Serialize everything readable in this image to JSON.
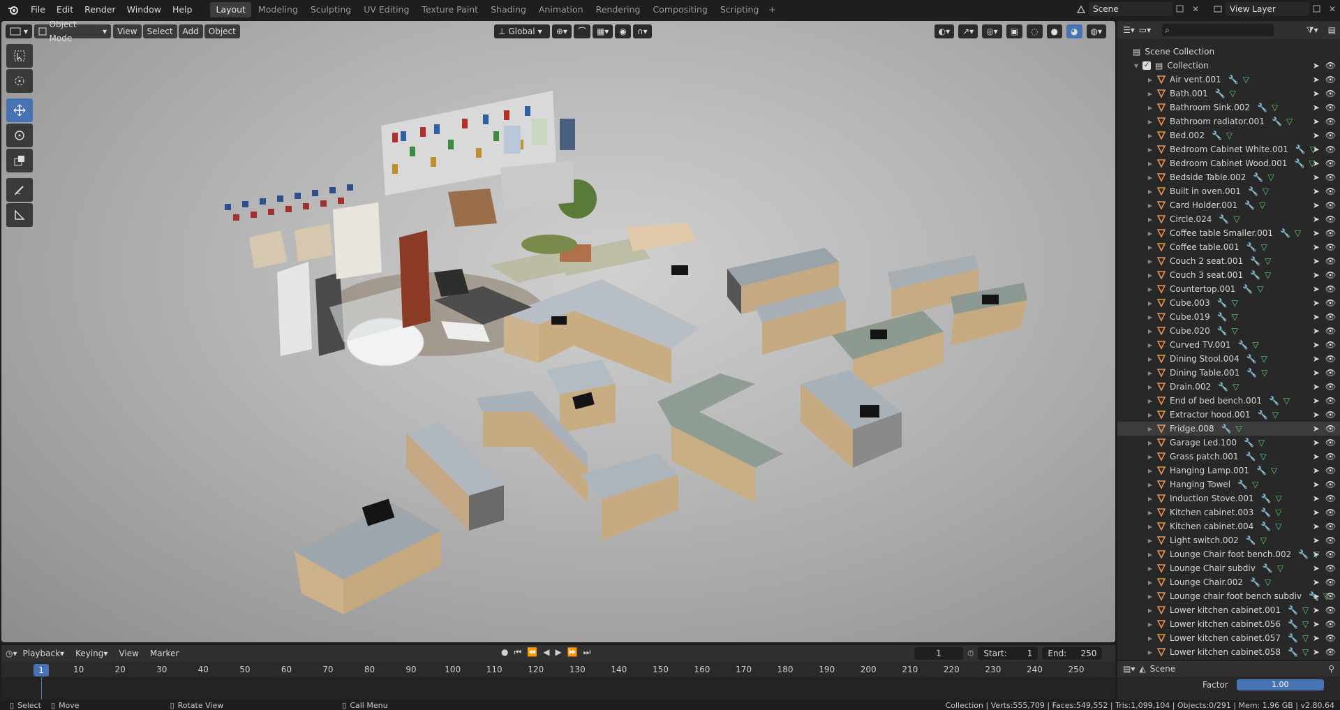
{
  "topbar": {
    "menus": [
      "File",
      "Edit",
      "Render",
      "Window",
      "Help"
    ],
    "workspaces": [
      "Layout",
      "Modeling",
      "Sculpting",
      "UV Editing",
      "Texture Paint",
      "Shading",
      "Animation",
      "Rendering",
      "Compositing",
      "Scripting"
    ],
    "active_workspace": "Layout",
    "scene_name": "Scene",
    "view_layer": "View Layer"
  },
  "viewport": {
    "mode": "Object Mode",
    "menus": [
      "View",
      "Select",
      "Add",
      "Object"
    ],
    "transform_orientation": "Global"
  },
  "outliner": {
    "root": "Scene Collection",
    "collection": "Collection",
    "items": [
      "Air vent.001",
      "Bath.001",
      "Bathroom Sink.002",
      "Bathroom radiator.001",
      "Bed.002",
      "Bedroom Cabinet White.001",
      "Bedroom Cabinet Wood.001",
      "Bedside Table.002",
      "Built in oven.001",
      "Card Holder.001",
      "Circle.024",
      "Coffee table Smaller.001",
      "Coffee table.001",
      "Couch 2 seat.001",
      "Couch 3 seat.001",
      "Countertop.001",
      "Cube.003",
      "Cube.019",
      "Cube.020",
      "Curved TV.001",
      "Dining Stool.004",
      "Dining Table.001",
      "Drain.002",
      "End of bed bench.001",
      "Extractor hood.001",
      "Fridge.008",
      "Garage Led.100",
      "Grass patch.001",
      "Hanging Lamp.001",
      "Hanging Towel",
      "Induction Stove.001",
      "Kitchen cabinet.003",
      "Kitchen cabinet.004",
      "Light switch.002",
      "Lounge Chair foot bench.002",
      "Lounge Chair subdiv",
      "Lounge Chair.002",
      "Lounge chair foot bench subdiv",
      "Lower kitchen cabinet.001",
      "Lower kitchen cabinet.056",
      "Lower kitchen cabinet.057",
      "Lower kitchen cabinet.058"
    ],
    "selected": "Fridge.008"
  },
  "properties": {
    "context": "Scene",
    "factor_label": "Factor",
    "factor_value": "1.00"
  },
  "timeline": {
    "menus": [
      "Playback",
      "Keying",
      "View",
      "Marker"
    ],
    "current_frame": "1",
    "start_label": "Start:",
    "start": "1",
    "end_label": "End:",
    "end": "250",
    "ticks": [
      "1",
      "10",
      "20",
      "30",
      "40",
      "50",
      "60",
      "70",
      "80",
      "90",
      "100",
      "110",
      "120",
      "130",
      "140",
      "150",
      "160",
      "170",
      "180",
      "190",
      "200",
      "210",
      "220",
      "230",
      "240",
      "250"
    ]
  },
  "statusbar": {
    "select": "Select",
    "move": "Move",
    "rotate": "Rotate View",
    "call_menu": "Call Menu",
    "stats": "Collection | Verts:555,709 | Faces:549,552 | Tris:1,099,104 | Objects:0/291 | Mem: 1.96 GB | v2.80.64"
  }
}
